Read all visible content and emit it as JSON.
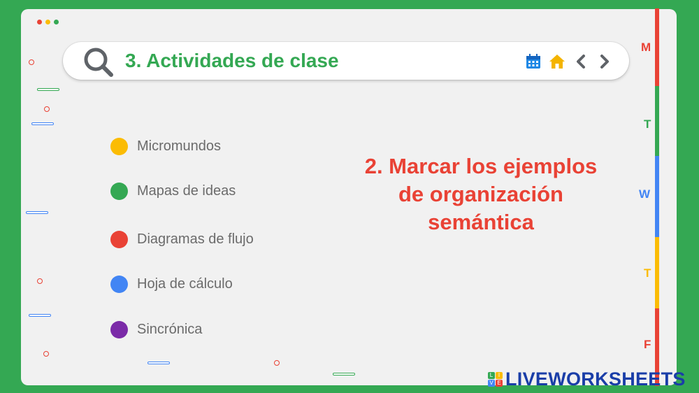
{
  "header": {
    "title": "3. Actividades de clase"
  },
  "toolbar": {
    "icons": [
      "calendar-icon",
      "home-icon",
      "chevron-left-icon",
      "chevron-right-icon"
    ]
  },
  "items": [
    {
      "label": "Micromundos",
      "color": "#fbbc04"
    },
    {
      "label": "Mapas de ideas",
      "color": "#34a853"
    },
    {
      "label": "Diagramas de flujo",
      "color": "#e94235"
    },
    {
      "label": "Hoja de cálculo",
      "color": "#4285f4"
    },
    {
      "label": "Sincrónica",
      "color": "#7b2ba8"
    }
  ],
  "instruction": {
    "line1": "2. Marcar los ejemplos",
    "line2": "de organización",
    "line3": "semántica"
  },
  "day_tabs": [
    {
      "letter": "M",
      "color": "#e94235"
    },
    {
      "letter": "T",
      "color": "#34a853"
    },
    {
      "letter": "W",
      "color": "#4285f4"
    },
    {
      "letter": "T",
      "color": "#fbbc04"
    },
    {
      "letter": "F",
      "color": "#e94235"
    }
  ],
  "brand": {
    "name": "LIVEWORKSHEETS",
    "logo_letters": [
      "L",
      "I",
      "V",
      "E"
    ]
  },
  "colors": {
    "background": "#34a853",
    "card": "#f1f1f1",
    "title": "#34a853",
    "instruction": "#e94235",
    "brand": "#1a3ea8"
  }
}
